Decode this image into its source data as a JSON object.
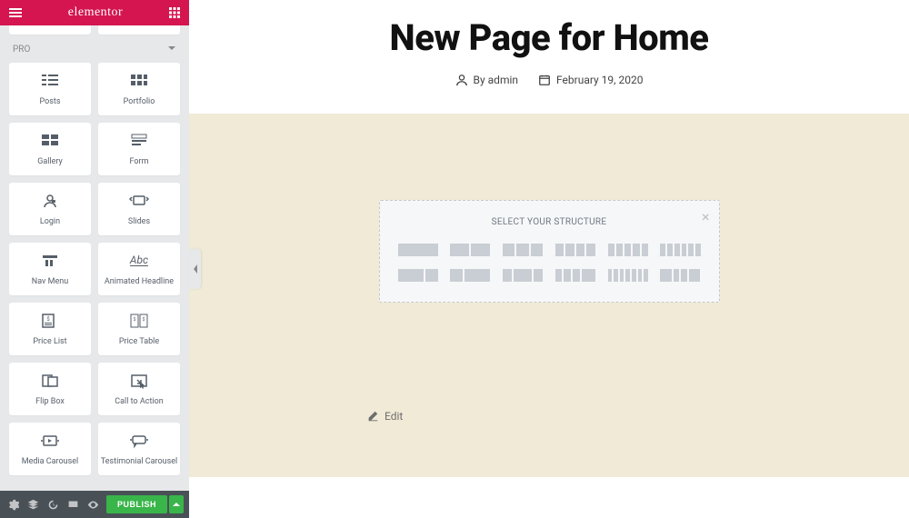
{
  "brand": "elementor",
  "pro_label": "PRO",
  "widgets": [
    {
      "label": "Posts",
      "icon": "posts"
    },
    {
      "label": "Portfolio",
      "icon": "portfolio"
    },
    {
      "label": "Gallery",
      "icon": "gallery"
    },
    {
      "label": "Form",
      "icon": "form"
    },
    {
      "label": "Login",
      "icon": "login"
    },
    {
      "label": "Slides",
      "icon": "slides"
    },
    {
      "label": "Nav Menu",
      "icon": "navmenu"
    },
    {
      "label": "Animated Headline",
      "icon": "headline"
    },
    {
      "label": "Price List",
      "icon": "pricelist"
    },
    {
      "label": "Price Table",
      "icon": "pricetable"
    },
    {
      "label": "Flip Box",
      "icon": "flipbox"
    },
    {
      "label": "Call to Action",
      "icon": "cta"
    },
    {
      "label": "Media Carousel",
      "icon": "mediacar"
    },
    {
      "label": "Testimonial Carousel",
      "icon": "testcar"
    }
  ],
  "footer": {
    "publish": "PUBLISH"
  },
  "page": {
    "title": "New Page for Home",
    "by_label": "By ",
    "author": "admin",
    "date": "February 19, 2020"
  },
  "structure": {
    "title": "SELECT YOUR STRUCTURE",
    "rows": [
      [
        1,
        2,
        3,
        4,
        5,
        6
      ],
      [
        7,
        8,
        9,
        10,
        11,
        12
      ]
    ]
  },
  "edit_label": "Edit"
}
